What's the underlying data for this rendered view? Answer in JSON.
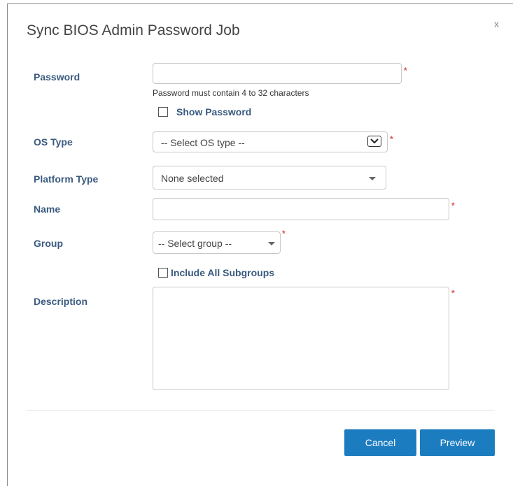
{
  "dialog": {
    "title": "Sync BIOS Admin Password Job",
    "close_label": "x"
  },
  "form": {
    "password": {
      "label": "Password",
      "value": "",
      "hint": "Password must contain 4 to 32 characters",
      "required_mark": "*"
    },
    "show_password": {
      "label": "Show Password",
      "checked": false
    },
    "os_type": {
      "label": "OS Type",
      "selected": "-- Select OS type --",
      "required_mark": "*"
    },
    "platform_type": {
      "label": "Platform Type",
      "selected": "None selected"
    },
    "name": {
      "label": "Name",
      "value": "",
      "required_mark": "*"
    },
    "group": {
      "label": "Group",
      "selected": "-- Select group --",
      "required_mark": "*"
    },
    "include_subgroups": {
      "label": "Include All Subgroups",
      "checked": false
    },
    "description": {
      "label": "Description",
      "value": "",
      "required_mark": "*"
    }
  },
  "footer": {
    "cancel_label": "Cancel",
    "preview_label": "Preview"
  },
  "colors": {
    "label": "#3a5a80",
    "required": "#d9534f",
    "button": "#1c7cc0"
  },
  "icons": {
    "close": "close-icon",
    "os_dropdown": "chevron-down-icon",
    "platform_dropdown": "caret-down-icon",
    "group_dropdown": "caret-down-icon"
  }
}
